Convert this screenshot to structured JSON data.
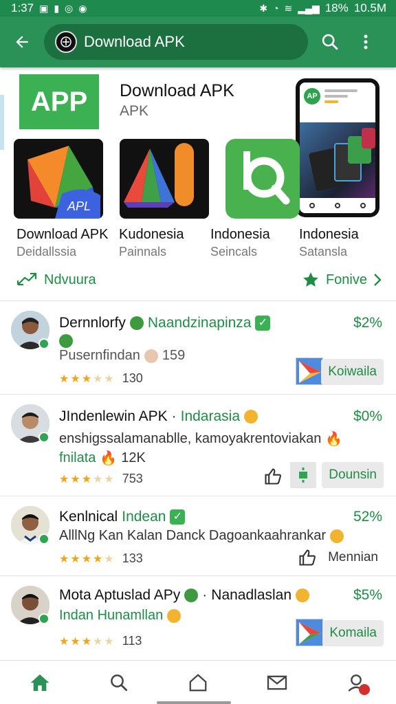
{
  "status_bar": {
    "time": "1:37",
    "battery": "18%",
    "clock_right": "10.5M"
  },
  "search_bar": {
    "text": "Download APK"
  },
  "header": {
    "badge_text": "APP",
    "title": "Download APK",
    "subtitle": "APK",
    "phone_logo_text": "AP"
  },
  "apps": [
    {
      "name": "Download APK",
      "sub": "Deidallssia",
      "icon_text": "APL"
    },
    {
      "name": "Kudonesia",
      "sub": "Painnals"
    },
    {
      "name": "Indonesia",
      "sub": "Seincals"
    },
    {
      "name": "Indonesia",
      "sub": "Satansla"
    }
  ],
  "hero_actions": {
    "left": "Ndvuura",
    "right": "Fonive"
  },
  "feed": [
    {
      "title": "Dernnlorfy",
      "title_tag": "Naandzinapinza",
      "percent": "$2%",
      "line1": "Pusernfindan",
      "line1_count": "159",
      "rating": 3.5,
      "rating_count": "130",
      "button": "Koiwaila"
    },
    {
      "title": "JIndenlewin APK",
      "title_tag": "Indarasia",
      "percent": "$0%",
      "line1": "enshigssalamanablle, kamoyakrentoviakan",
      "line2": "fnilata",
      "line2_count": "12K",
      "rating": 3,
      "rating_count": "753",
      "button": "Dounsin"
    },
    {
      "title": "Kenlnical",
      "title_tag": "Indean",
      "percent": "52%",
      "line1": "AlllNg Kan Kalan Danck Dagoankaahrankar",
      "rating": 3.5,
      "rating_count": "133",
      "button": "Mennian"
    },
    {
      "title": "Mota Aptuslad APy",
      "title_tag": "Nanadlaslan",
      "percent": "$5%",
      "line1": "Indan Hunamllan",
      "rating": 3,
      "rating_count": "113",
      "button": "Komaila"
    }
  ],
  "icons": {
    "back": "arrow-left-icon",
    "search": "search-icon",
    "more": "more-vert-icon",
    "nav": [
      "home-icon",
      "search-icon",
      "home-outline-icon",
      "mail-icon",
      "profile-icon"
    ]
  },
  "colors": {
    "primary": "#2a9257",
    "accent_green": "#1f8c45",
    "star": "#f2a416"
  }
}
